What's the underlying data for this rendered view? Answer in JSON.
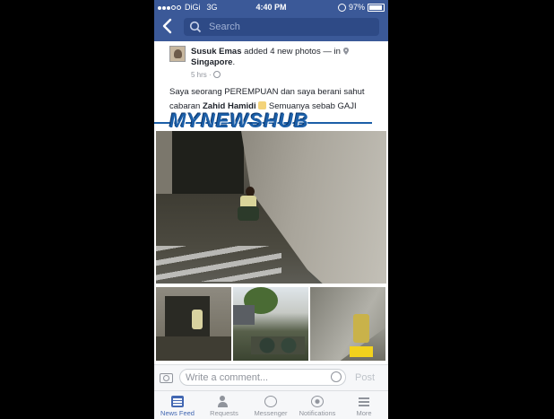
{
  "status_bar": {
    "carrier": "DiGi",
    "network": "3G",
    "time": "4:40 PM",
    "battery": "97%"
  },
  "search": {
    "placeholder": "Search"
  },
  "post": {
    "author": "Susuk Emas",
    "action": " added 4 new photos — in ",
    "location": "Singapore",
    "time": "5 hrs",
    "text_part1": "Saya seorang PEREMPUAN dan saya berani sahut cabaran ",
    "text_bold": "Zahid Hamidi",
    "text_part2": " Semuanya sebab GAJI"
  },
  "watermark": {
    "text": "MYNEWSHUB"
  },
  "comment_bar": {
    "placeholder": "Write a comment...",
    "post_label": "Post"
  },
  "tabs": [
    {
      "label": "News Feed",
      "icon": "news-feed-icon",
      "active": true
    },
    {
      "label": "Requests",
      "icon": "requests-icon",
      "active": false
    },
    {
      "label": "Messenger",
      "icon": "messenger-icon",
      "active": false
    },
    {
      "label": "Notifications",
      "icon": "notifications-icon",
      "active": false
    },
    {
      "label": "More",
      "icon": "more-icon",
      "active": false
    }
  ],
  "colors": {
    "brand": "#3b5998",
    "active_tab": "#4267b2"
  }
}
